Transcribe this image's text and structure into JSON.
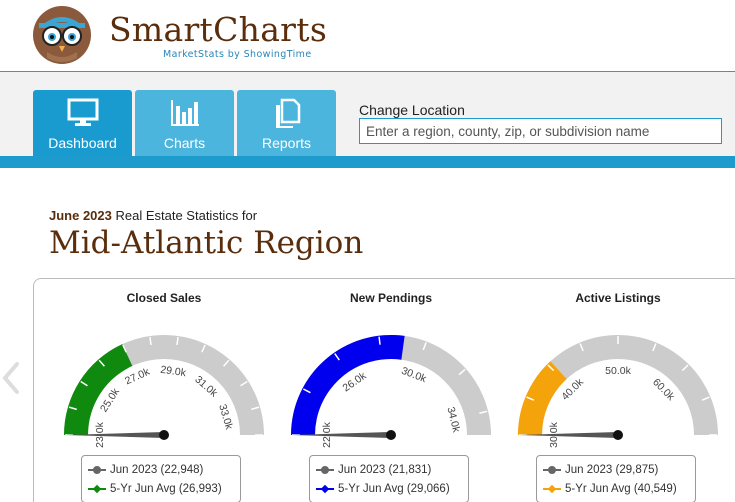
{
  "brand": {
    "name": "SmartCharts",
    "subtitle": "MarketStats by ShowingTime"
  },
  "nav": {
    "tabs": [
      {
        "label": "Dashboard",
        "icon": "monitor-icon",
        "active": true
      },
      {
        "label": "Charts",
        "icon": "bar-chart-icon",
        "active": false
      },
      {
        "label": "Reports",
        "icon": "documents-icon",
        "active": false
      }
    ],
    "change_location": {
      "label": "Change Location",
      "placeholder": "Enter a region, county, zip, or subdivision name"
    }
  },
  "page": {
    "period": "June 2023",
    "period_suffix": " Real Estate Statistics for",
    "region": "Mid-Atlantic Region"
  },
  "colors": {
    "brand_brown": "#5a2d0c",
    "nav_blue": "#1a9bd0",
    "green": "#0f8a0f",
    "blue": "#0000ee",
    "orange": "#f5a30a",
    "gray_arc": "#cccccc",
    "needle": "#555555"
  },
  "chart_data": [
    {
      "type": "gauge",
      "title": "Closed Sales",
      "min": 23000,
      "max": 34000,
      "ticks": [
        "23.0k",
        "25.0k",
        "27.0k",
        "29.0k",
        "31.0k",
        "33.0k"
      ],
      "tick_values": [
        23000,
        25000,
        27000,
        29000,
        31000,
        33000
      ],
      "current": 22948,
      "average": 26993,
      "series": [
        {
          "name": "Jun 2023 (22,948)",
          "value": 22948,
          "color": "#666666"
        },
        {
          "name": "5-Yr Jun Avg (26,993)",
          "value": 26993,
          "color": "#0f8a0f"
        }
      ]
    },
    {
      "type": "gauge",
      "title": "New Pendings",
      "min": 22000,
      "max": 35000,
      "ticks": [
        "22.0k",
        "26.0k",
        "30.0k",
        "34.0k"
      ],
      "tick_values": [
        22000,
        26000,
        30000,
        34000
      ],
      "current": 21831,
      "average": 29066,
      "series": [
        {
          "name": "Jun 2023 (21,831)",
          "value": 21831,
          "color": "#666666"
        },
        {
          "name": "5-Yr Jun Avg (29,066)",
          "value": 29066,
          "color": "#0000ee"
        }
      ]
    },
    {
      "type": "gauge",
      "title": "Active Listings",
      "min": 30000,
      "max": 70000,
      "ticks": [
        "30.0k",
        "40.0k",
        "50.0k",
        "60.0k"
      ],
      "tick_values": [
        30000,
        40000,
        50000,
        60000
      ],
      "current": 29875,
      "average": 40549,
      "series": [
        {
          "name": "Jun 2023 (29,875)",
          "value": 29875,
          "color": "#666666"
        },
        {
          "name": "5-Yr Jun Avg (40,549)",
          "value": 40549,
          "color": "#f5a30a"
        }
      ]
    }
  ]
}
